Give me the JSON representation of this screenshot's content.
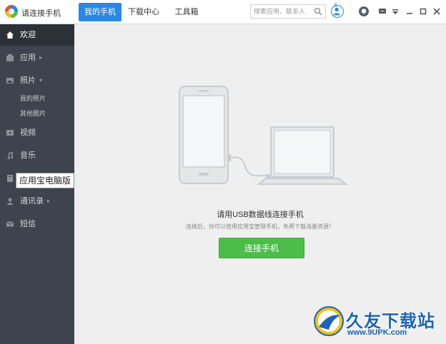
{
  "app": {
    "title": "请连接手机"
  },
  "tabs": [
    {
      "label": "我的手机",
      "active": true
    },
    {
      "label": "下载中心",
      "active": false
    },
    {
      "label": "工具箱",
      "active": false
    }
  ],
  "search": {
    "placeholder": "搜索应用、联系人"
  },
  "user": {
    "badge": "4"
  },
  "window_controls": [
    "bell-icon",
    "chat-icon",
    "menu-icon",
    "minimize-icon",
    "maximize-icon",
    "close-icon"
  ],
  "sidebar": {
    "items": [
      {
        "label": "欢迎",
        "icon": "home-icon",
        "active": true
      },
      {
        "label": "应用",
        "icon": "app-icon",
        "arrow": "▸"
      },
      {
        "label": "照片",
        "icon": "photo-icon",
        "arrow": "▾"
      },
      {
        "label": "视频",
        "icon": "video-icon"
      },
      {
        "label": "音乐",
        "icon": "music-icon"
      },
      {
        "label": "电子书",
        "icon": "book-icon"
      },
      {
        "label": "通讯录",
        "icon": "contacts-icon",
        "arrow": "▸"
      },
      {
        "label": "短信",
        "icon": "sms-icon"
      }
    ],
    "photo_subitems": [
      "我的照片",
      "其他图片"
    ],
    "tooltip": "应用宝电脑版"
  },
  "main": {
    "title": "请用USB数据线连接手机",
    "subtitle": "连接后，你可以使用应用宝管理手机，免费下载海量资源！",
    "button_label": "连接手机"
  },
  "watermark": {
    "text": "久友下载站",
    "url": "www.9UPK.com"
  },
  "colors": {
    "accent": "#2a87e4",
    "sidebar": "#3e444d",
    "button": "#4dbd4a"
  }
}
